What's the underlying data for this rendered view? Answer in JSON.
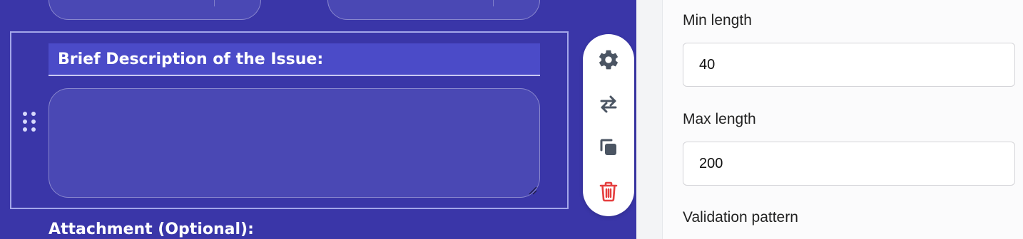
{
  "form_canvas": {
    "question_label": "Brief Description of the Issue:",
    "next_question_label": "Attachment (Optional):"
  },
  "toolbar": {
    "settings_icon": "gear-icon",
    "swap_icon": "swap-arrows-icon",
    "duplicate_icon": "copy-icon",
    "delete_icon": "trash-icon",
    "delete_color": "#e53e3e"
  },
  "settings_panel": {
    "min_length": {
      "label": "Min length",
      "value": "40"
    },
    "max_length": {
      "label": "Max length",
      "value": "200"
    },
    "validation_pattern": {
      "label": "Validation pattern"
    }
  },
  "colors": {
    "canvas_background": "#3a36a8",
    "accent": "#4b4bc8"
  }
}
